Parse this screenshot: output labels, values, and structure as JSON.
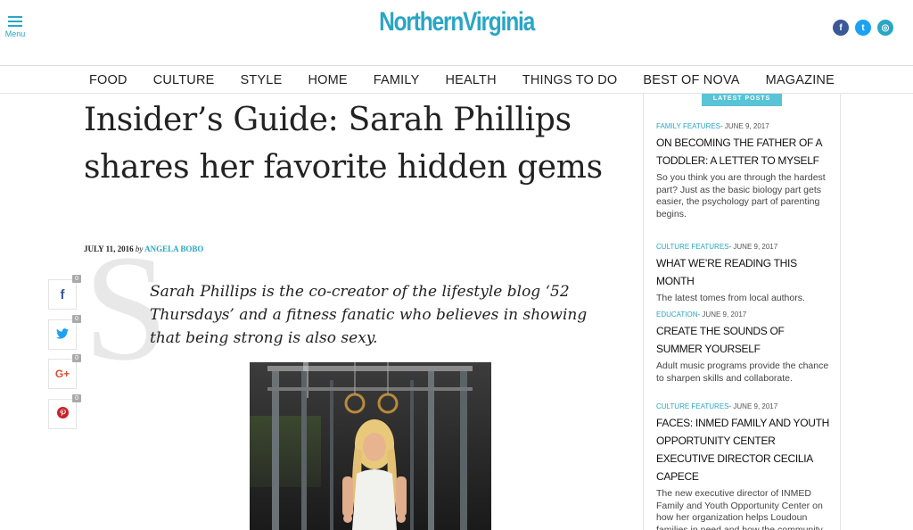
{
  "header": {
    "menu_label": "Menu",
    "logo": "NorthernVirginia",
    "social": [
      {
        "icon": "facebook-icon",
        "glyph": "f",
        "color": "#3b5998"
      },
      {
        "icon": "twitter-icon",
        "glyph": "t",
        "color": "#1da1f2"
      },
      {
        "icon": "instagram-icon",
        "glyph": "◎",
        "color": "#2aa6c4"
      }
    ]
  },
  "nav": [
    "FOOD",
    "CULTURE",
    "STYLE",
    "HOME",
    "FAMILY",
    "HEALTH",
    "THINGS TO DO",
    "BEST OF NOVA",
    "MAGAZINE"
  ],
  "article": {
    "title": "Insider’s Guide: Sarah Phillips shares her favorite hidden gems",
    "date": "JULY 11, 2016",
    "by": "by",
    "author": "ANGELA BOBO",
    "dropcap": "S",
    "lede": "Sarah Phillips is the co-creator of the lifestyle blog ‘52 Thursdays’ and a fitness fanatic who believes in showing that being strong is also sexy."
  },
  "share": [
    {
      "icon": "facebook-icon",
      "glyph": "f",
      "color": "#3b5998",
      "count": "0"
    },
    {
      "icon": "twitter-icon",
      "glyph": "🐦",
      "color": "#1da1f2",
      "count": "0"
    },
    {
      "icon": "google-plus-icon",
      "glyph": "G+",
      "color": "#dd4b39",
      "count": "0"
    },
    {
      "icon": "pinterest-icon",
      "glyph": "P",
      "color": "#cb2027",
      "count": "0"
    }
  ],
  "sidebar": {
    "badge": "LATEST POSTS",
    "posts": [
      {
        "category": "FAMILY FEATURES",
        "date": "- JUNE 9, 2017",
        "headline": "ON BECOMING THE FATHER OF A TODDLER: A LETTER TO MYSELF",
        "excerpt": "So you think you are through the hardest part? Just as the basic biology part gets easier, the psychology part of parenting begins."
      },
      {
        "category": "CULTURE FEATURES",
        "date": "- JUNE 9, 2017",
        "headline": "WHAT WE’RE READING THIS MONTH",
        "excerpt": "The latest tomes from local authors."
      },
      {
        "category": "EDUCATION",
        "date": "- JUNE 9, 2017",
        "headline": "CREATE THE SOUNDS OF SUMMER YOURSELF",
        "excerpt": "Adult music programs provide the chance to sharpen skills and collaborate."
      },
      {
        "category": "CULTURE FEATURES",
        "date": "- JUNE 9, 2017",
        "headline": "FACES: INMED FAMILY AND YOUTH OPPORTUNITY CENTER EXECUTIVE DIRECTOR CECILIA CAPECE",
        "excerpt": "The new executive director of INMED Family and Youth Opportunity Center on how her organization helps Loudoun families in need and how the community can pitch in."
      }
    ]
  }
}
